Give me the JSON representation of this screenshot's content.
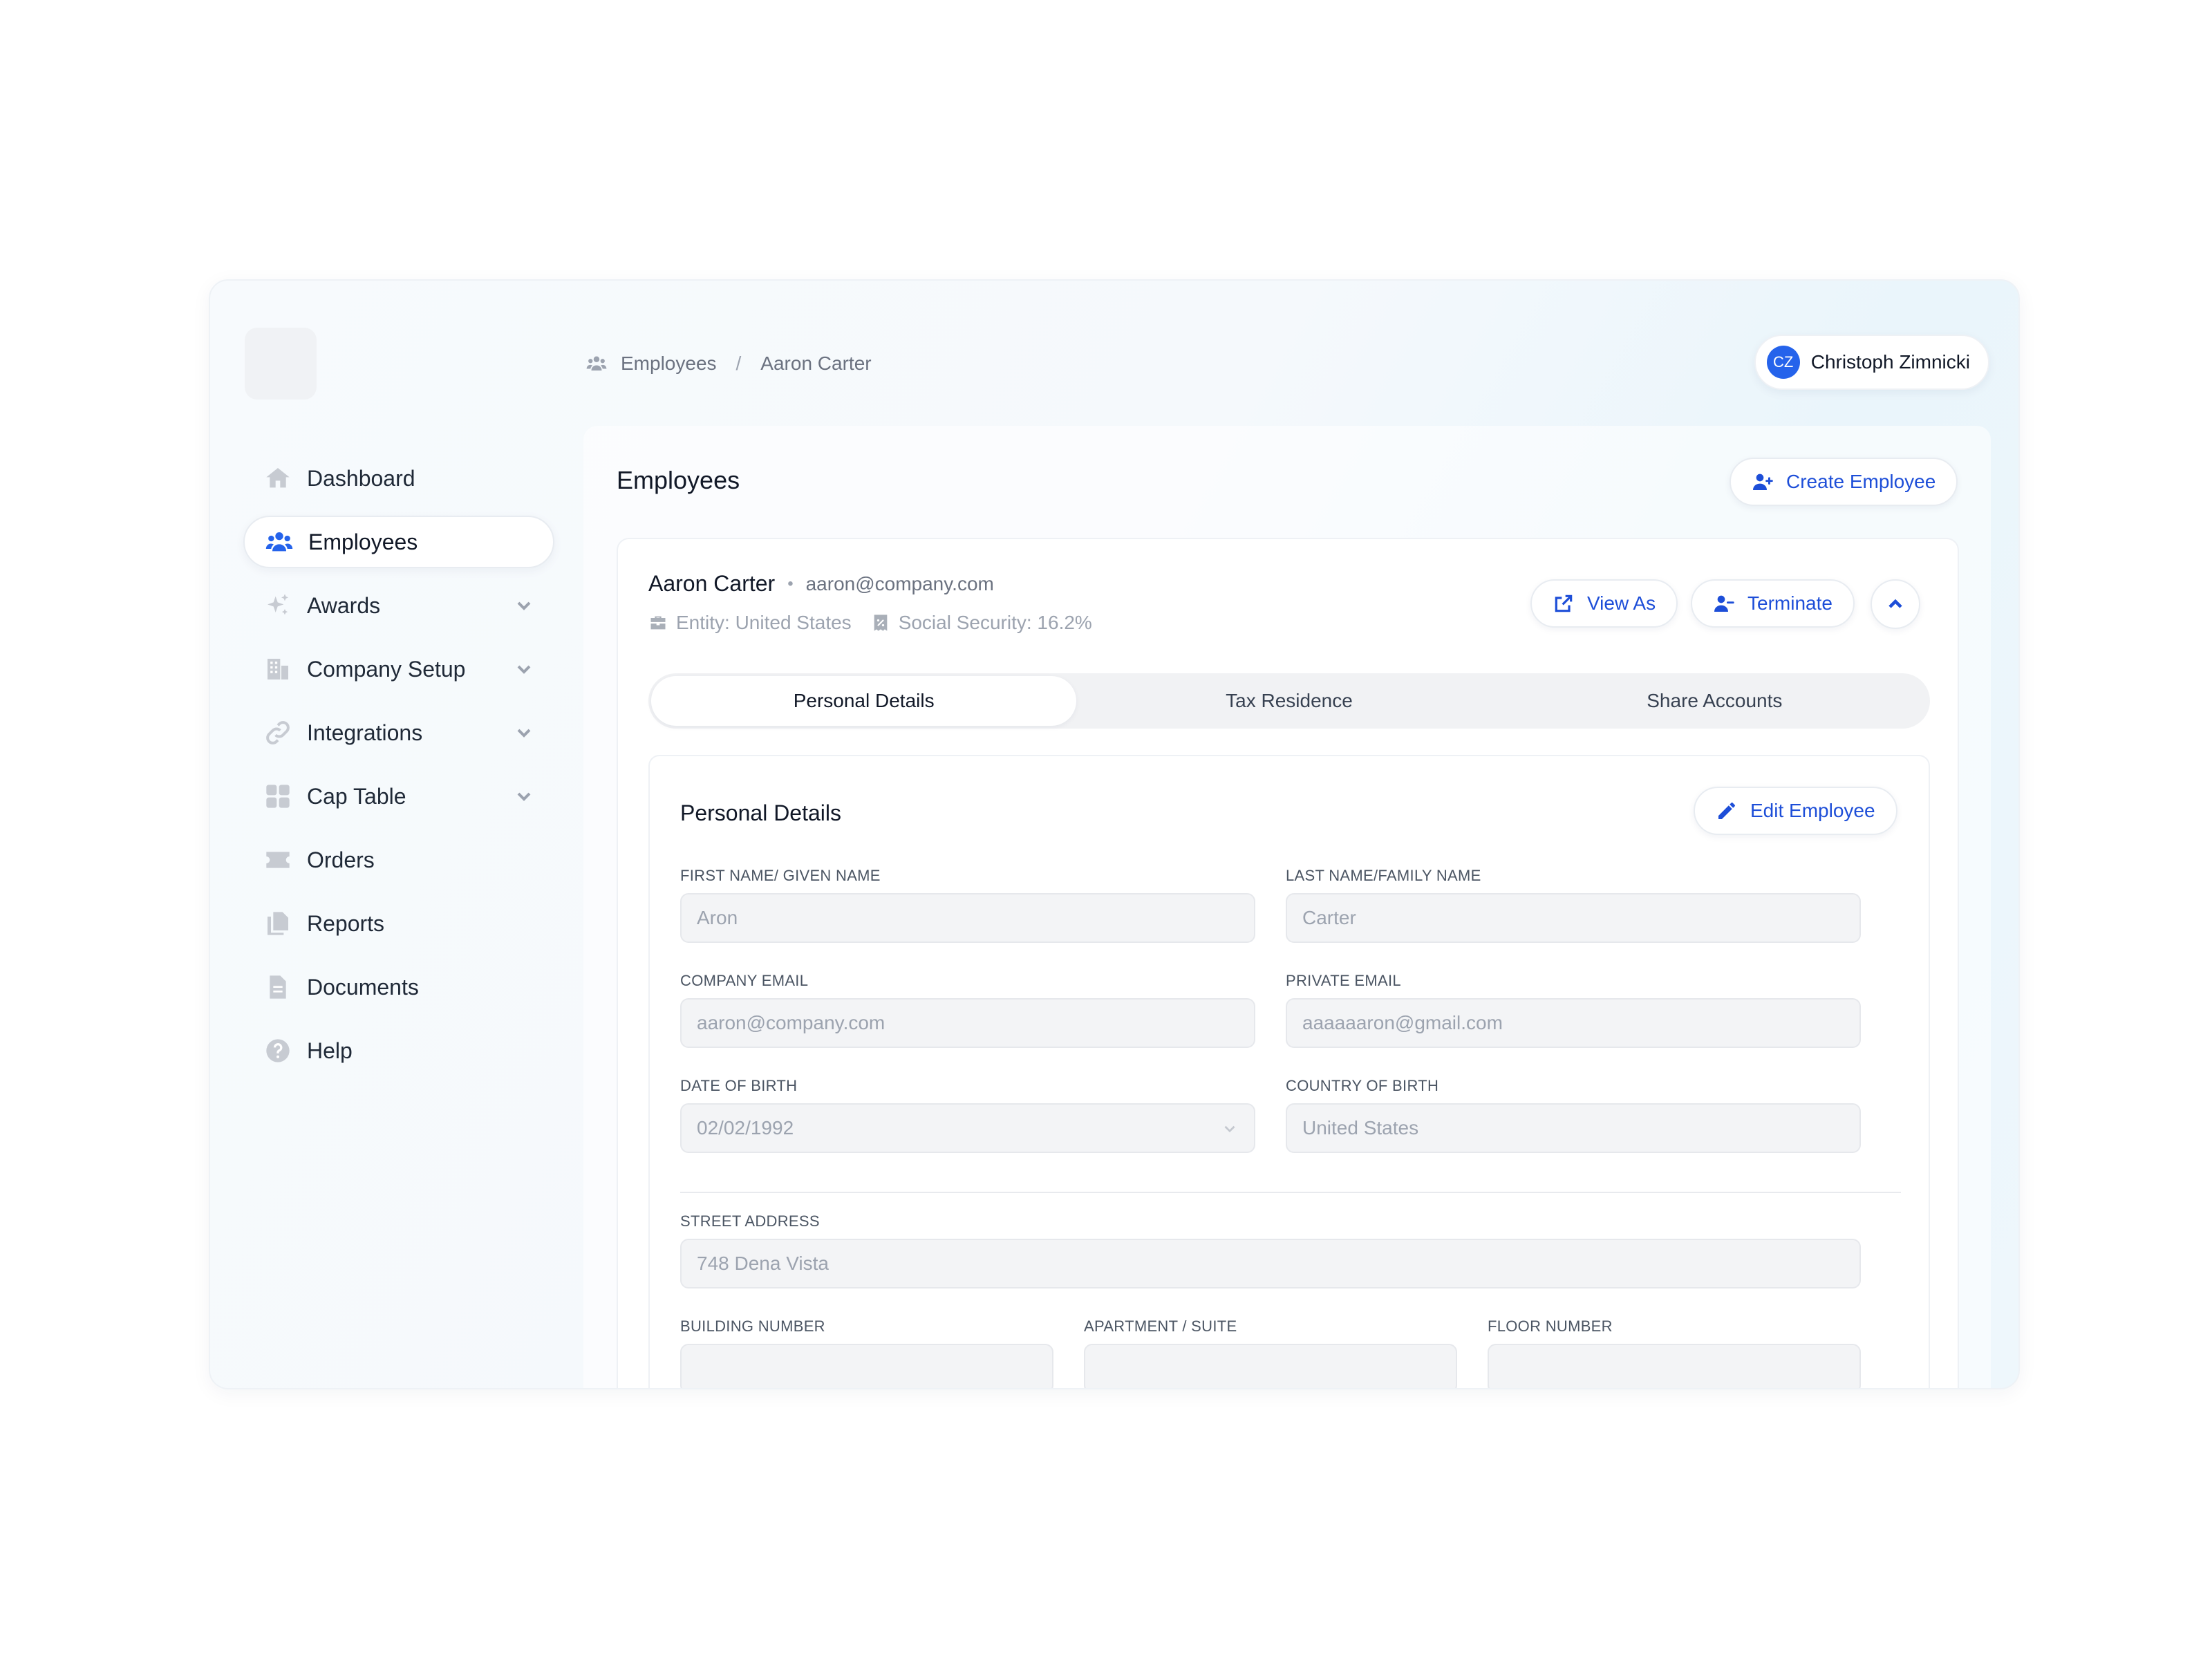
{
  "breadcrumb": {
    "section": "Employees",
    "separator": "/",
    "current": "Aaron Carter"
  },
  "user": {
    "initials": "CZ",
    "name": "Christoph Zimnicki"
  },
  "sidebar": {
    "items": [
      {
        "label": "Dashboard",
        "icon": "home-icon",
        "active": false,
        "expandable": false
      },
      {
        "label": "Employees",
        "icon": "users-icon",
        "active": true,
        "expandable": false
      },
      {
        "label": "Awards",
        "icon": "sparkles-icon",
        "active": false,
        "expandable": true
      },
      {
        "label": "Company Setup",
        "icon": "building-icon",
        "active": false,
        "expandable": true
      },
      {
        "label": "Integrations",
        "icon": "link-icon",
        "active": false,
        "expandable": true
      },
      {
        "label": "Cap Table",
        "icon": "grid-icon",
        "active": false,
        "expandable": true
      },
      {
        "label": "Orders",
        "icon": "ticket-icon",
        "active": false,
        "expandable": false
      },
      {
        "label": "Reports",
        "icon": "documents-icon",
        "active": false,
        "expandable": false
      },
      {
        "label": "Documents",
        "icon": "document-icon",
        "active": false,
        "expandable": false
      },
      {
        "label": "Help",
        "icon": "help-icon",
        "active": false,
        "expandable": false
      }
    ]
  },
  "main": {
    "title": "Employees",
    "create_button": "Create Employee"
  },
  "employee": {
    "name": "Aaron Carter",
    "email": "aaron@company.com",
    "entity": "Entity: United States",
    "social_security": "Social Security: 16.2%",
    "view_as_button": "View As",
    "terminate_button": "Terminate"
  },
  "tabs": [
    {
      "label": "Personal Details",
      "active": true
    },
    {
      "label": "Tax Residence",
      "active": false
    },
    {
      "label": "Share Accounts",
      "active": false
    }
  ],
  "personal_details": {
    "title": "Personal Details",
    "edit_button": "Edit Employee",
    "fields": {
      "first_name": {
        "label": "FIRST NAME/ GIVEN NAME",
        "value": "Aron"
      },
      "last_name": {
        "label": "LAST NAME/FAMILY NAME",
        "value": "Carter"
      },
      "company_email": {
        "label": "COMPANY EMAIL",
        "value": "aaron@company.com"
      },
      "private_email": {
        "label": "PRIVATE EMAIL",
        "value": "aaaaaaron@gmail.com"
      },
      "date_of_birth": {
        "label": "DATE OF BIRTH",
        "value": "02/02/1992"
      },
      "country_of_birth": {
        "label": "COUNTRY OF BIRTH",
        "value": "United States"
      },
      "street_address": {
        "label": "STREET ADDRESS",
        "value": "748 Dena Vista"
      },
      "building_number": {
        "label": "BUILDING NUMBER",
        "value": ""
      },
      "apartment": {
        "label": "APARTMENT / SUITE",
        "value": ""
      },
      "floor_number": {
        "label": "FLOOR NUMBER",
        "value": ""
      }
    }
  },
  "colors": {
    "accent": "#2563eb",
    "text": "#111827",
    "muted": "#6b7280",
    "field_bg": "#f3f4f6"
  }
}
